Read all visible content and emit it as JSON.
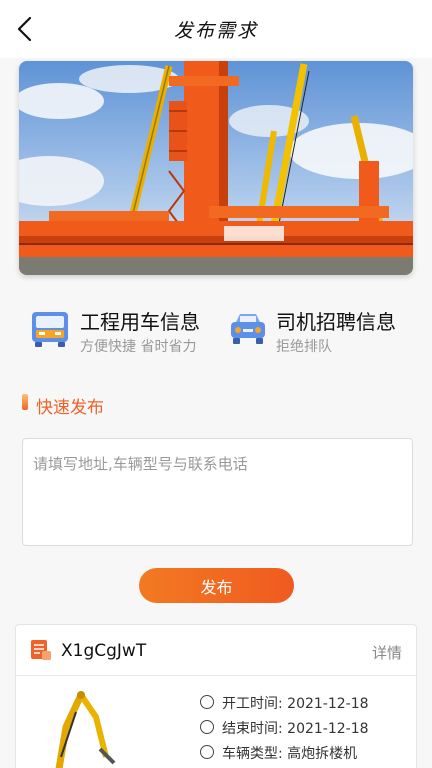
{
  "nav": {
    "title": "发布需求"
  },
  "features": [
    {
      "title": "工程用车信息",
      "subtitle": "方便快捷 省时省力",
      "icon": "truck-icon"
    },
    {
      "title": "司机招聘信息",
      "subtitle": "拒绝排队",
      "icon": "car-icon"
    }
  ],
  "quick_publish": {
    "label": "快速发布",
    "placeholder": "请填写地址,车辆型号与联系电话",
    "button_label": "发布"
  },
  "card": {
    "title": "X1gCgJwT",
    "detail_label": "详情",
    "rows": [
      {
        "text": "开工时间: 2021-12-18"
      },
      {
        "text": "结束时间: 2021-12-18"
      },
      {
        "text": "车辆类型: 高炮拆楼机"
      }
    ]
  },
  "colors": {
    "accent": "#f0622a",
    "crane_orange": "#f05a1a",
    "crane_yellow": "#f5b800"
  }
}
